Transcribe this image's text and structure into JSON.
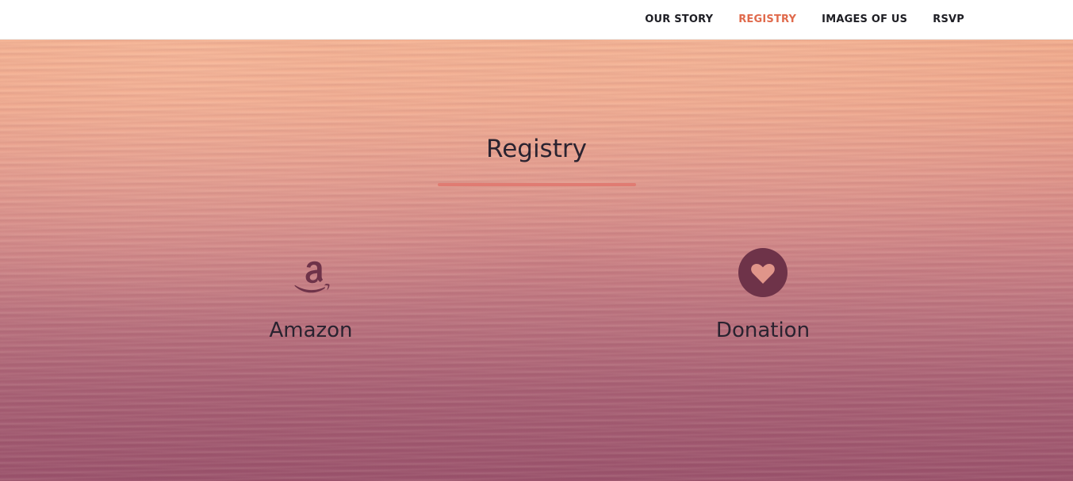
{
  "nav": {
    "items": [
      {
        "label": "OUR STORY",
        "active": false
      },
      {
        "label": "REGISTRY",
        "active": true
      },
      {
        "label": "IMAGES OF US",
        "active": false
      },
      {
        "label": "RSVP",
        "active": false
      }
    ]
  },
  "section": {
    "title": "Registry"
  },
  "registry": {
    "items": [
      {
        "label": "Amazon",
        "icon": "amazon-icon"
      },
      {
        "label": "Donation",
        "icon": "heart-circle-icon"
      }
    ]
  },
  "colors": {
    "nav_active": "#e06a4c",
    "nav_text": "#1e1e24",
    "underline": "#e07b72",
    "icon": "#6e3349",
    "text_dark": "#2a2330"
  }
}
